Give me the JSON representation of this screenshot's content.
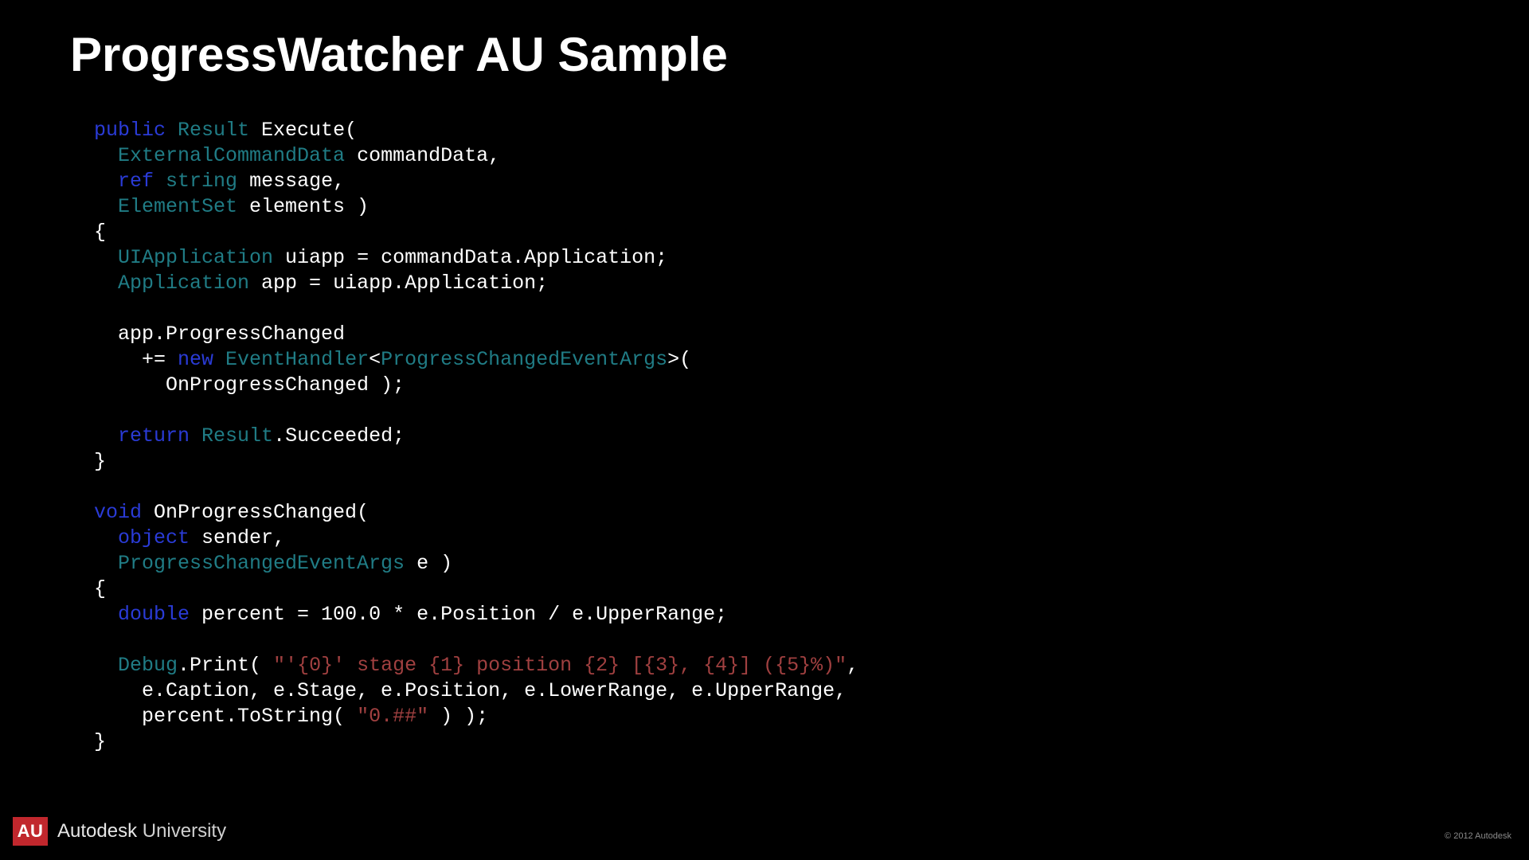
{
  "title": "ProgressWatcher AU Sample",
  "code": {
    "l1_kw": "public",
    "l1_type": " Result",
    "l1_rest": " Execute(",
    "l2_type": "  ExternalCommandData",
    "l2_rest": " commandData,",
    "l3_lead": "  ",
    "l3_kw": "ref",
    "l3_type": " string",
    "l3_rest": " message,",
    "l4_type": "  ElementSet",
    "l4_rest": " elements )",
    "l5": "{",
    "l6_type": "  UIApplication",
    "l6_rest": " uiapp = commandData.Application;",
    "l7_type": "  Application",
    "l7_rest": " app = uiapp.Application;",
    "l8": "",
    "l9": "  app.ProgressChanged",
    "l10_lead": "    += ",
    "l10_kw": "new",
    "l10_type1": " EventHandler",
    "l10_lt": "<",
    "l10_type2": "ProgressChangedEventArgs",
    "l10_gt": ">(",
    "l11": "      OnProgressChanged );",
    "l12": "",
    "l13_lead": "  ",
    "l13_kw": "return",
    "l13_type": " Result",
    "l13_rest": ".Succeeded;",
    "l14": "}",
    "l15": "",
    "l16_kw": "void",
    "l16_rest": " OnProgressChanged(",
    "l17_lead": "  ",
    "l17_kw": "object",
    "l17_rest": " sender,",
    "l18_type": "  ProgressChangedEventArgs",
    "l18_rest": " e )",
    "l19": "{",
    "l20_lead": "  ",
    "l20_kw": "double",
    "l20_rest": " percent = 100.0 * e.Position / e.UpperRange;",
    "l21": "",
    "l22_lead": "  ",
    "l22_type": "Debug",
    "l22_mid": ".Print( ",
    "l22_str": "\"'{0}' stage {1} position {2} [{3}, {4}] ({5}%)\"",
    "l22_end": ",",
    "l23": "    e.Caption, e.Stage, e.Position, e.LowerRange, e.UpperRange,",
    "l24_lead": "    percent.ToString( ",
    "l24_str": "\"0.##\"",
    "l24_end": " ) );",
    "l25": "}"
  },
  "footer": {
    "badge": "AU",
    "brand_bold": "Autodesk",
    "brand_light": " University",
    "copyright": "© 2012 Autodesk"
  }
}
